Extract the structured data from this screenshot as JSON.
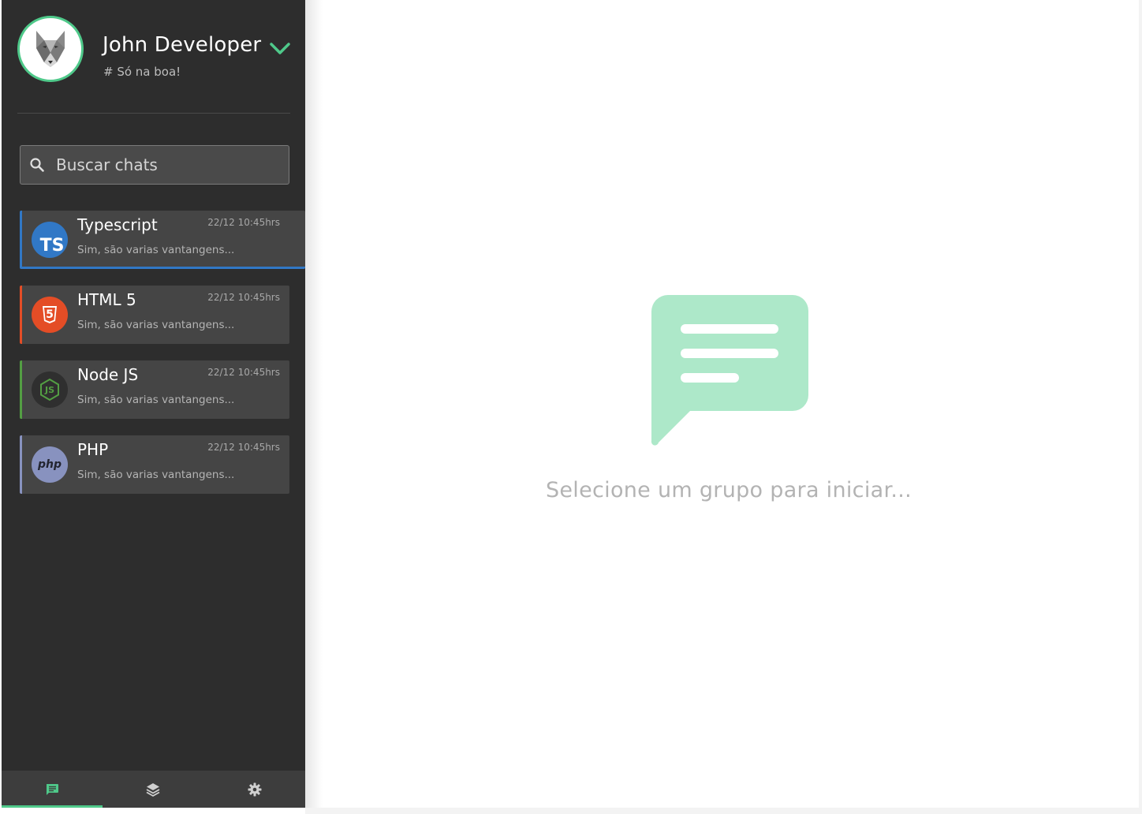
{
  "user": {
    "name": "John Developer",
    "status": "# Só na boa!"
  },
  "search": {
    "placeholder": "Buscar chats"
  },
  "chats": [
    {
      "name": "Typescript",
      "time": "22/12 10:45hrs",
      "preview": "Sim, são varias vantangens...",
      "icon_label": "TS",
      "color": "#3178c6",
      "active": true
    },
    {
      "name": "HTML 5",
      "time": "22/12 10:45hrs",
      "preview": "Sim, são varias vantangens...",
      "icon_label": "5",
      "color": "#e44d26",
      "active": false
    },
    {
      "name": "Node JS",
      "time": "22/12 10:45hrs",
      "preview": "Sim, são varias vantangens...",
      "icon_label": "JS",
      "color": "#539e43",
      "active": false
    },
    {
      "name": "PHP",
      "time": "22/12 10:45hrs",
      "preview": "Sim, são varias vantangens...",
      "icon_label": "php",
      "color": "#8892bf",
      "active": false
    }
  ],
  "nav": {
    "tabs": [
      {
        "icon": "chat-icon",
        "active": true
      },
      {
        "icon": "layers-icon",
        "active": false
      },
      {
        "icon": "gear-icon",
        "active": false
      }
    ]
  },
  "main": {
    "empty_message": "Selecione um grupo para iniciar..."
  },
  "colors": {
    "accent": "#4fc98a",
    "sidebar_bg": "#2d2d2d",
    "empty_icon": "#ade8c9"
  }
}
